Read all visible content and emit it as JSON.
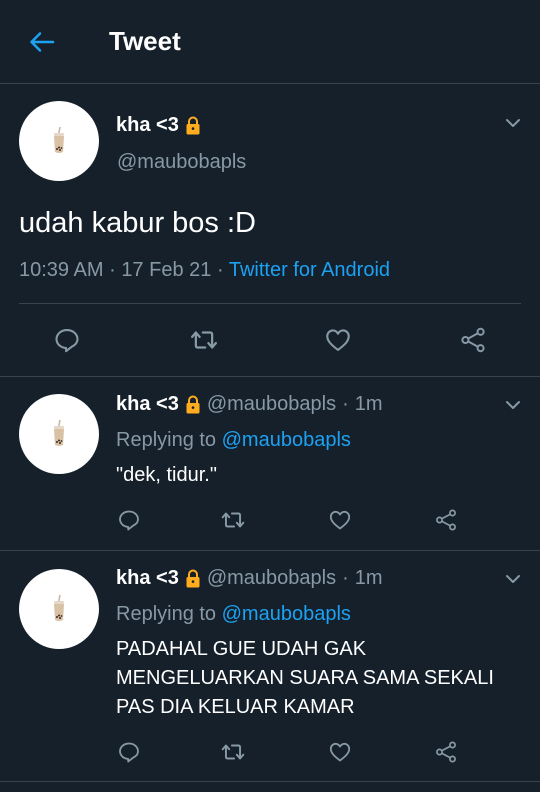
{
  "header": {
    "title": "Tweet"
  },
  "main_tweet": {
    "name": "kha <3",
    "handle": "@maubobapls",
    "text": "udah kabur bos :D",
    "time": "10:39 AM",
    "sep1": "·",
    "date": "17 Feb 21",
    "sep2": "·",
    "source": "Twitter for Android"
  },
  "replies": [
    {
      "name": "kha <3",
      "handle": "@maubobapls",
      "dot": "·",
      "age": "1m",
      "replying_prefix": "Replying to",
      "replying_to": "@maubobapls",
      "text": "\"dek, tidur.\""
    },
    {
      "name": "kha <3",
      "handle": "@maubobapls",
      "dot": "·",
      "age": "1m",
      "replying_prefix": "Replying to",
      "replying_to": "@maubobapls",
      "text": "PADAHAL GUE UDAH GAK MENGELUARKAN SUARA SAMA SEKALI PAS DIA KELUAR KAMAR"
    }
  ],
  "icons": {
    "back": "arrow-left-icon",
    "lock": "lock-icon",
    "avatar": "bubble-tea-avatar",
    "chevron": "chevron-down-icon",
    "reply": "reply-icon",
    "retweet": "retweet-icon",
    "like": "heart-icon",
    "share": "share-icon"
  },
  "colors": {
    "background": "#15202b",
    "accent": "#1da1f2",
    "secondary_text": "#8899a6",
    "divider": "#38444d",
    "lock": "#ffad1f"
  }
}
